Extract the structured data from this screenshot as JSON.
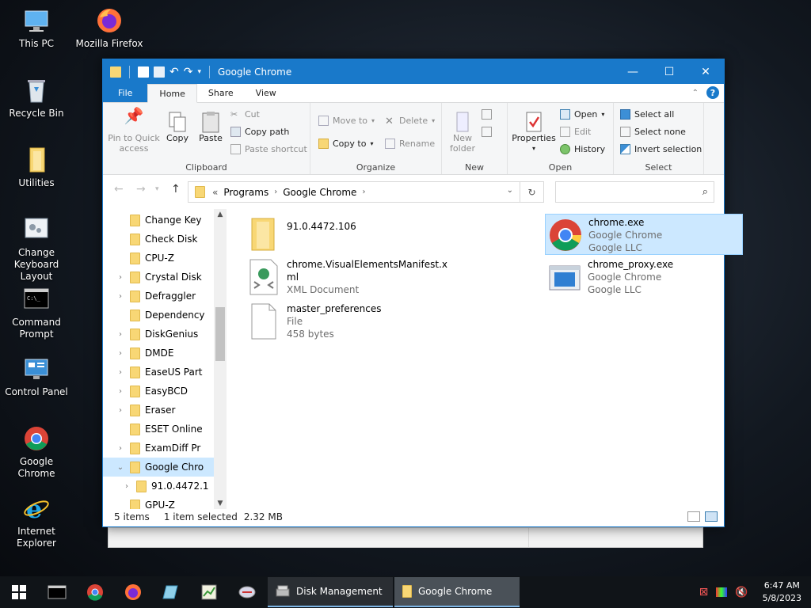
{
  "desktop": {
    "icons": [
      {
        "label": "This PC"
      },
      {
        "label": "Mozilla Firefox"
      },
      {
        "label": "Recycle Bin"
      },
      {
        "label": "Utilities"
      },
      {
        "label": "Change Keyboard Layout"
      },
      {
        "label": "Command Prompt"
      },
      {
        "label": "Control Panel"
      },
      {
        "label": "Google Chrome"
      },
      {
        "label": "Internet Explorer"
      }
    ]
  },
  "window": {
    "title": "Google Chrome",
    "tabs": {
      "file": "File",
      "home": "Home",
      "share": "Share",
      "view": "View"
    },
    "ribbon": {
      "clipboard": {
        "label": "Clipboard",
        "pin": "Pin to Quick access",
        "copy": "Copy",
        "paste": "Paste",
        "cut": "Cut",
        "copy_path": "Copy path",
        "paste_shortcut": "Paste shortcut"
      },
      "organize": {
        "label": "Organize",
        "move_to": "Move to",
        "copy_to": "Copy to",
        "delete": "Delete",
        "rename": "Rename"
      },
      "new": {
        "label": "New",
        "new_folder": "New folder"
      },
      "open": {
        "label": "Open",
        "properties": "Properties",
        "open": "Open",
        "edit": "Edit",
        "history": "History"
      },
      "select": {
        "label": "Select",
        "select_all": "Select all",
        "select_none": "Select none",
        "invert": "Invert selection"
      }
    },
    "address": {
      "prefix": "«",
      "crumbs": [
        "Programs",
        "Google Chrome"
      ],
      "search_placeholder": ""
    },
    "nav_items": [
      {
        "label": "Change Key",
        "expandable": false
      },
      {
        "label": "Check Disk",
        "expandable": false
      },
      {
        "label": "CPU-Z",
        "expandable": false
      },
      {
        "label": "Crystal Disk",
        "expandable": true
      },
      {
        "label": "Defraggler",
        "expandable": true
      },
      {
        "label": "Dependency",
        "expandable": false
      },
      {
        "label": "DiskGenius",
        "expandable": true
      },
      {
        "label": "DMDE",
        "expandable": true
      },
      {
        "label": "EaseUS Part",
        "expandable": true
      },
      {
        "label": "EasyBCD",
        "expandable": true
      },
      {
        "label": "Eraser",
        "expandable": true
      },
      {
        "label": "ESET Online",
        "expandable": false
      },
      {
        "label": "ExamDiff Pr",
        "expandable": true
      },
      {
        "label": "Google Chro",
        "expandable": true,
        "expanded": true,
        "selected": true
      },
      {
        "label": "91.0.4472.1",
        "expandable": true,
        "child": true
      },
      {
        "label": "GPU-Z",
        "expandable": false
      }
    ],
    "files": [
      {
        "name": "91.0.4472.106",
        "line2": "",
        "line3": "",
        "icon": "folder-icon"
      },
      {
        "name": "chrome.exe",
        "line2": "Google Chrome",
        "line3": "Google LLC",
        "icon": "chrome-icon",
        "selected": true
      },
      {
        "name": "chrome.VisualElementsManifest.x",
        "name2": "ml",
        "line2": "XML Document",
        "line3": "",
        "icon": "xml-file-icon"
      },
      {
        "name": "chrome_proxy.exe",
        "line2": "Google Chrome",
        "line3": "Google LLC",
        "icon": "exe-window-icon"
      },
      {
        "name": "master_preferences",
        "line2": "File",
        "line3": "458 bytes",
        "icon": "blank-file-icon"
      }
    ],
    "status": {
      "items": "5 items",
      "selected": "1 item selected",
      "size": "2.32 MB"
    }
  },
  "taskbar": {
    "apps": [
      {
        "label": "Disk Management"
      },
      {
        "label": "Google Chrome"
      }
    ],
    "time": "6:47 AM",
    "date": "5/8/2023"
  },
  "colors": {
    "accent": "#1979ca",
    "selection": "#cce8ff",
    "folder": "#f8d775"
  }
}
